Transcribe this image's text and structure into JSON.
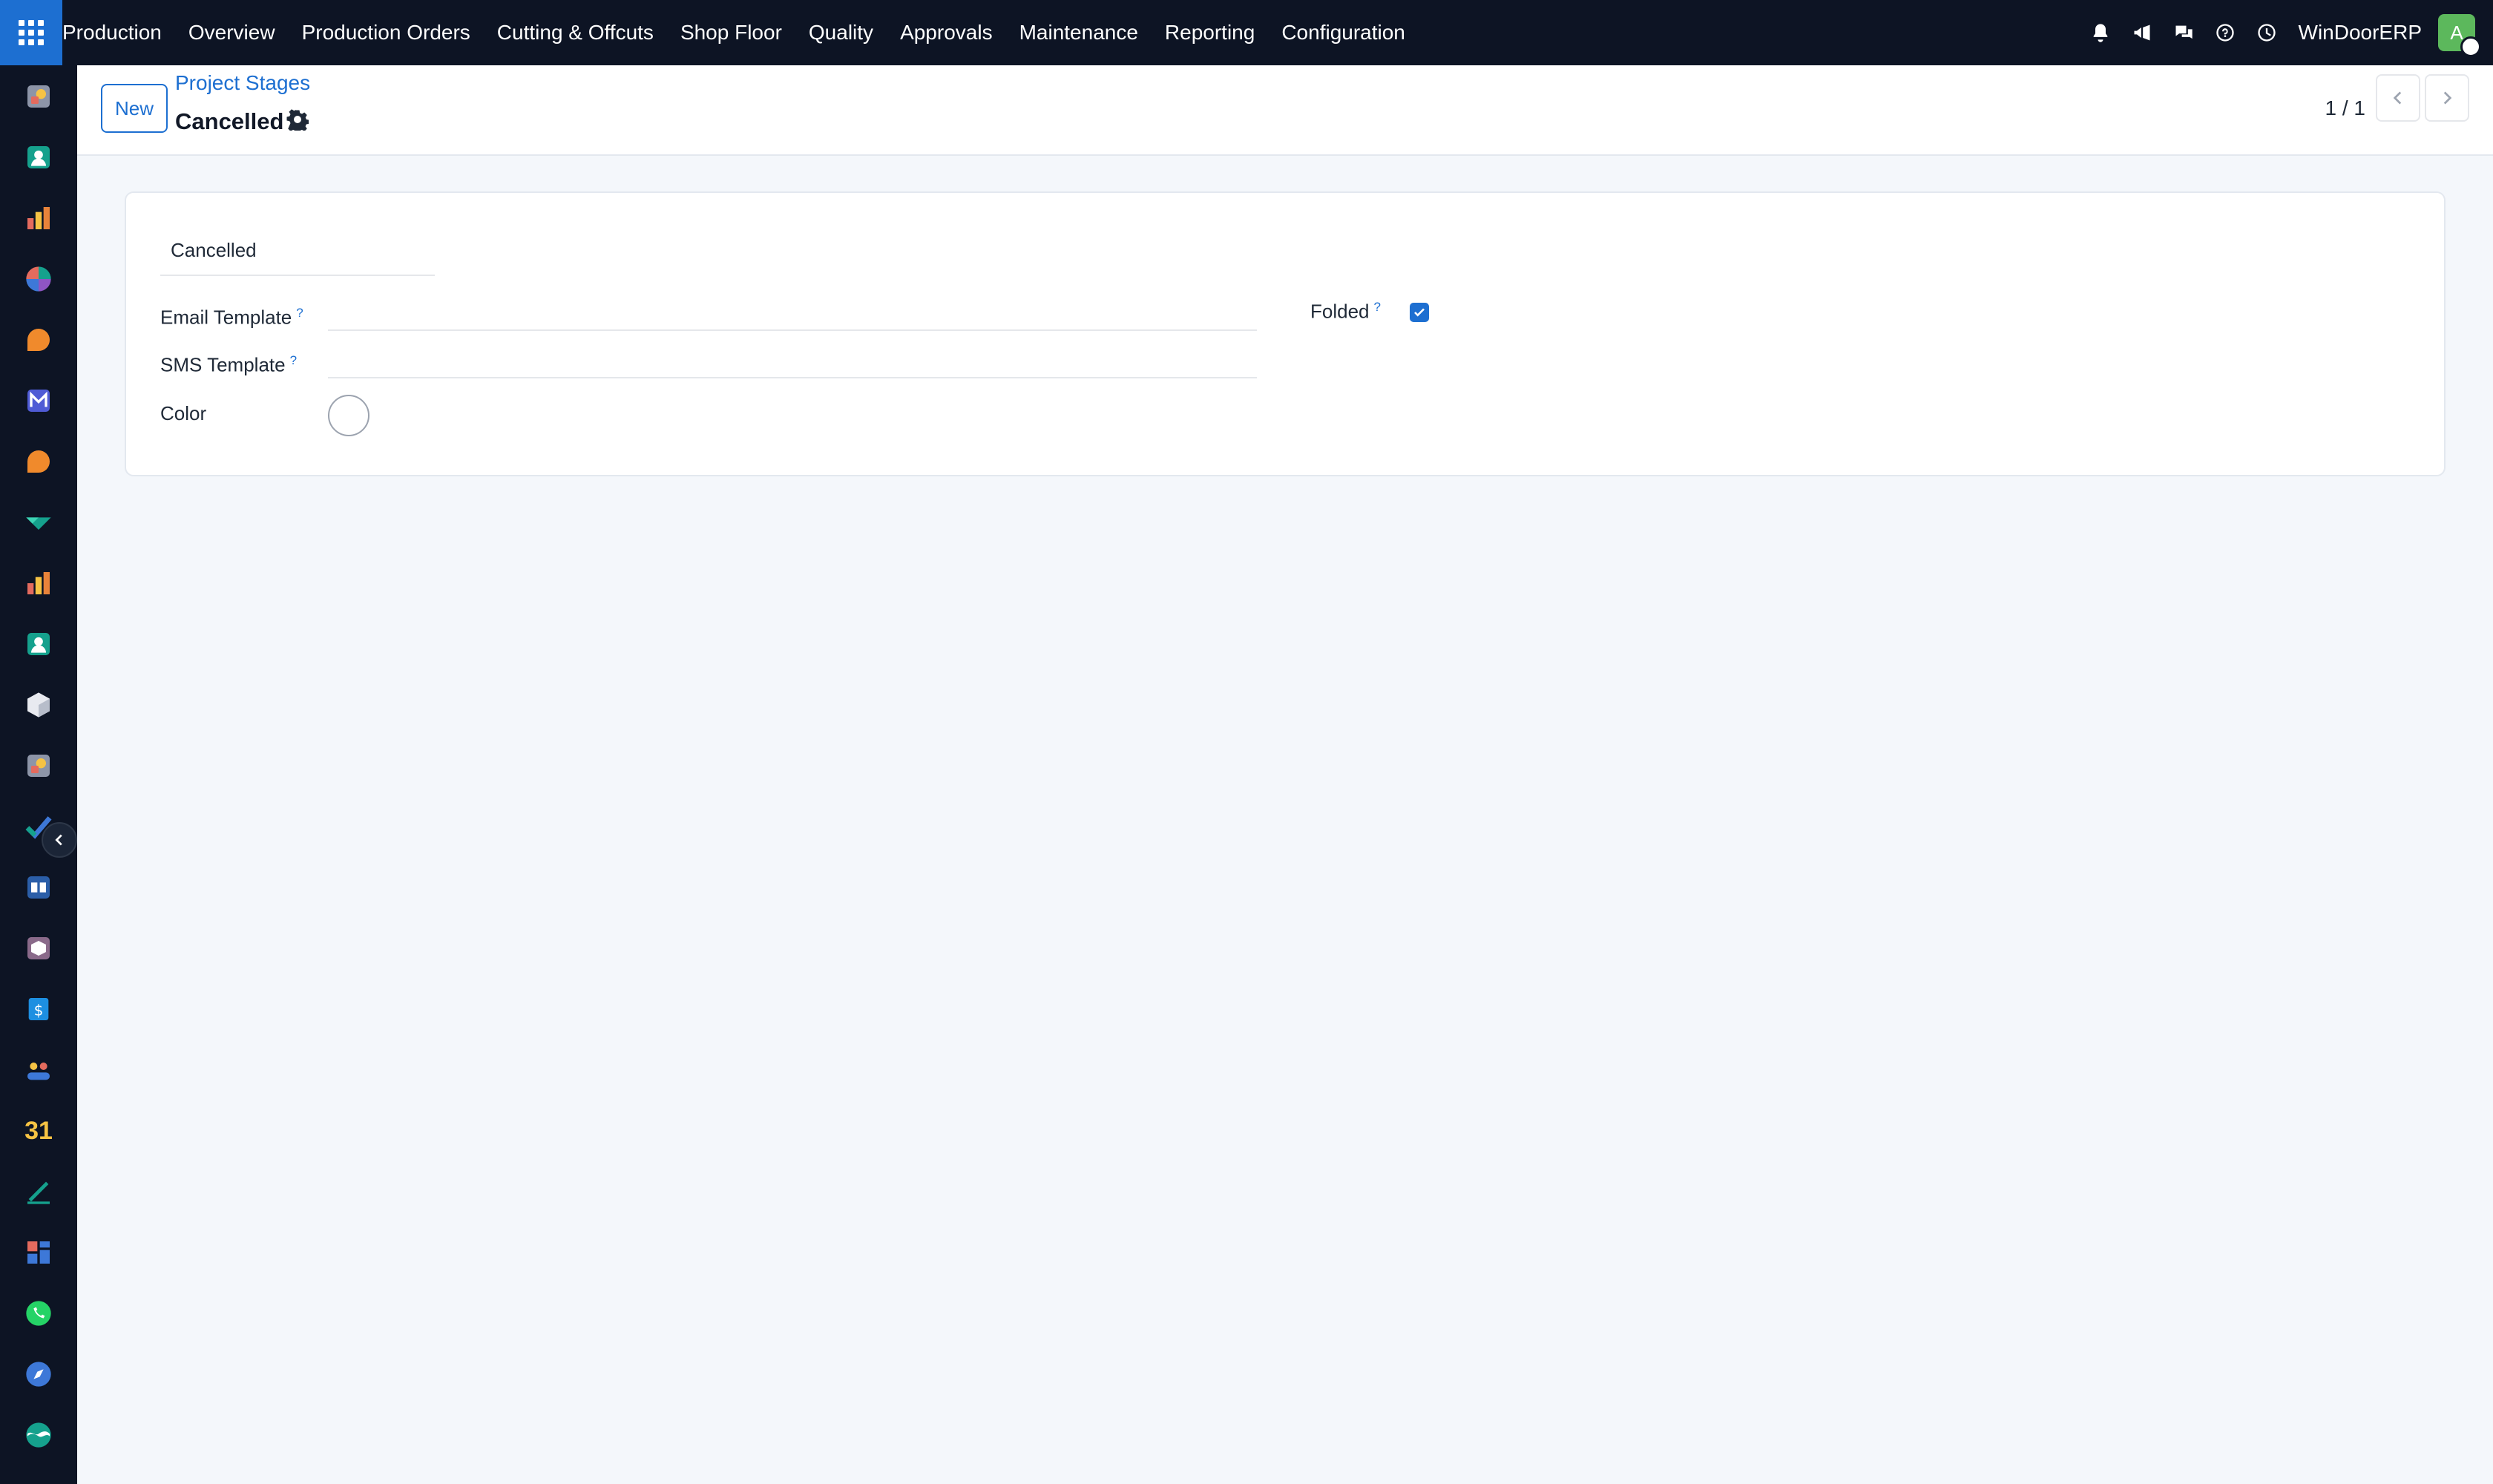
{
  "topbar": {
    "app_name": "Production",
    "menu": [
      "Overview",
      "Production Orders",
      "Cutting & Offcuts",
      "Shop Floor",
      "Quality",
      "Approvals",
      "Maintenance",
      "Reporting",
      "Configuration"
    ],
    "company": "WinDoorERP",
    "avatar_letter": "A",
    "avatar_color": "#5cb85c"
  },
  "sidebar": {
    "apps": [
      "app-icon",
      "contacts-icon",
      "chart-icon",
      "pie-icon",
      "chat-icon",
      "mail-icon",
      "chat-icon",
      "tag-icon",
      "chart-icon",
      "contacts-icon",
      "cube-icon",
      "app-icon",
      "check-icon",
      "book-icon",
      "box-icon",
      "invoice-icon",
      "people-icon",
      "calendar-icon",
      "sign-icon",
      "dashboard-icon",
      "whatsapp-icon",
      "compass-icon",
      "wave-icon"
    ],
    "calendar_label": "31"
  },
  "control_panel": {
    "new_label": "New",
    "breadcrumb": "Project Stages",
    "record_title": "Cancelled",
    "pager": "1 / 1"
  },
  "form": {
    "name_value": "Cancelled",
    "email_template_label": "Email Template",
    "sms_template_label": "SMS Template",
    "color_label": "Color",
    "folded_label": "Folded",
    "folded_checked": true,
    "help_mark": "?"
  },
  "colors": {
    "navbar": "#0d1424",
    "primary": "#1d6fd1",
    "background": "#f4f7fb"
  }
}
